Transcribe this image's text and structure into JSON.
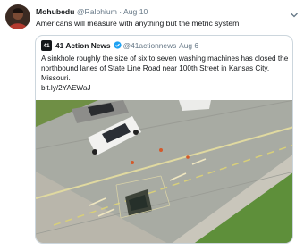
{
  "tweet": {
    "author_name": "Mohubedu",
    "author_handle": "@Ralphium",
    "separator": "·",
    "date": "Aug 10",
    "text": "Americans will measure with anything but the metric system",
    "icons": {
      "avatar": "user-avatar",
      "menu": "chevron-down-icon"
    }
  },
  "quoted_tweet": {
    "source_logo_text": "41",
    "author_name": "41 Action News",
    "author_handle": "@41actionnews",
    "separator": "·",
    "date": "Aug 6",
    "text": "A sinkhole roughly the size of six to seven washing machines has closed the northbound lanes of State Line Road near 100th Street in Kansas City, Missouri.",
    "link": "bit.ly/2YAEWaJ",
    "icons": {
      "logo": "station-logo",
      "verified": "verified-badge-icon",
      "media": "aerial-sinkhole-photo"
    }
  },
  "colors": {
    "text": "#14171a",
    "secondary": "#657786",
    "border": "#ccd6dd",
    "verified": "#1da1f2"
  }
}
